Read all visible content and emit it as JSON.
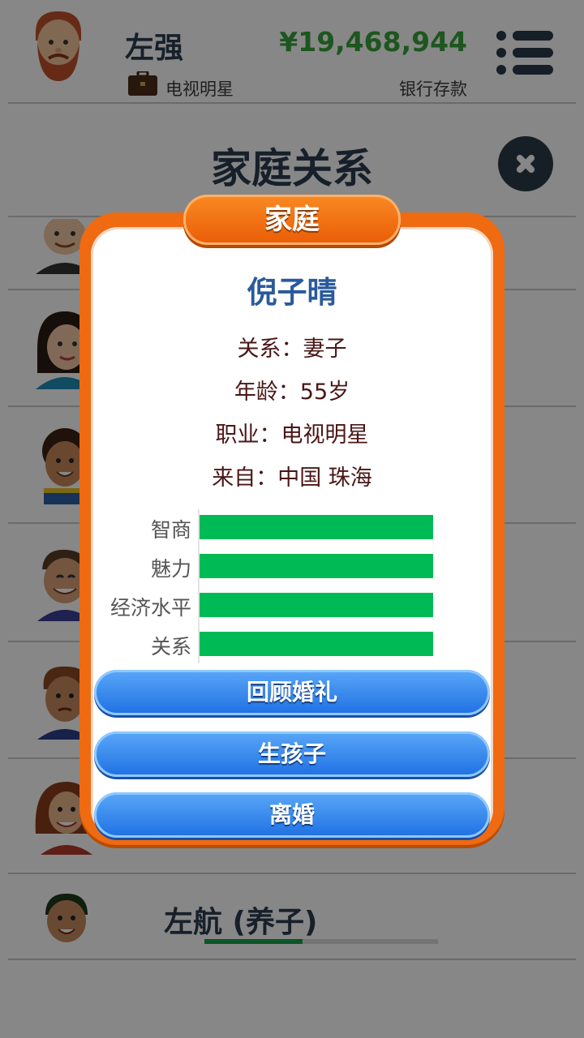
{
  "header": {
    "player_name": "左强",
    "job": "电视明星",
    "money": "¥19,468,944",
    "money_label": "银行存款"
  },
  "section_title": "家庭关系",
  "background_list": {
    "last_row_name": "左航 (养子)",
    "last_row_bar_fill": 0.42,
    "row6_bar_fill": 0.42
  },
  "modal": {
    "tab_label": "家庭",
    "person_name": "倪子晴",
    "info": [
      "关系：妻子",
      "年龄：55岁",
      "职业：电视明星",
      "来自：中国 珠海"
    ],
    "stats": [
      {
        "label": "智商",
        "value": 1.0
      },
      {
        "label": "魅力",
        "value": 1.0
      },
      {
        "label": "经济水平",
        "value": 1.0
      },
      {
        "label": "关系",
        "value": 1.0
      }
    ],
    "buttons": [
      "回顾婚礼",
      "生孩子",
      "离婚"
    ]
  },
  "colors": {
    "money": "#37a33a",
    "modal_orange": "#ef6a10",
    "stat_green": "#00bb55",
    "button_blue": "#2f86ee"
  }
}
